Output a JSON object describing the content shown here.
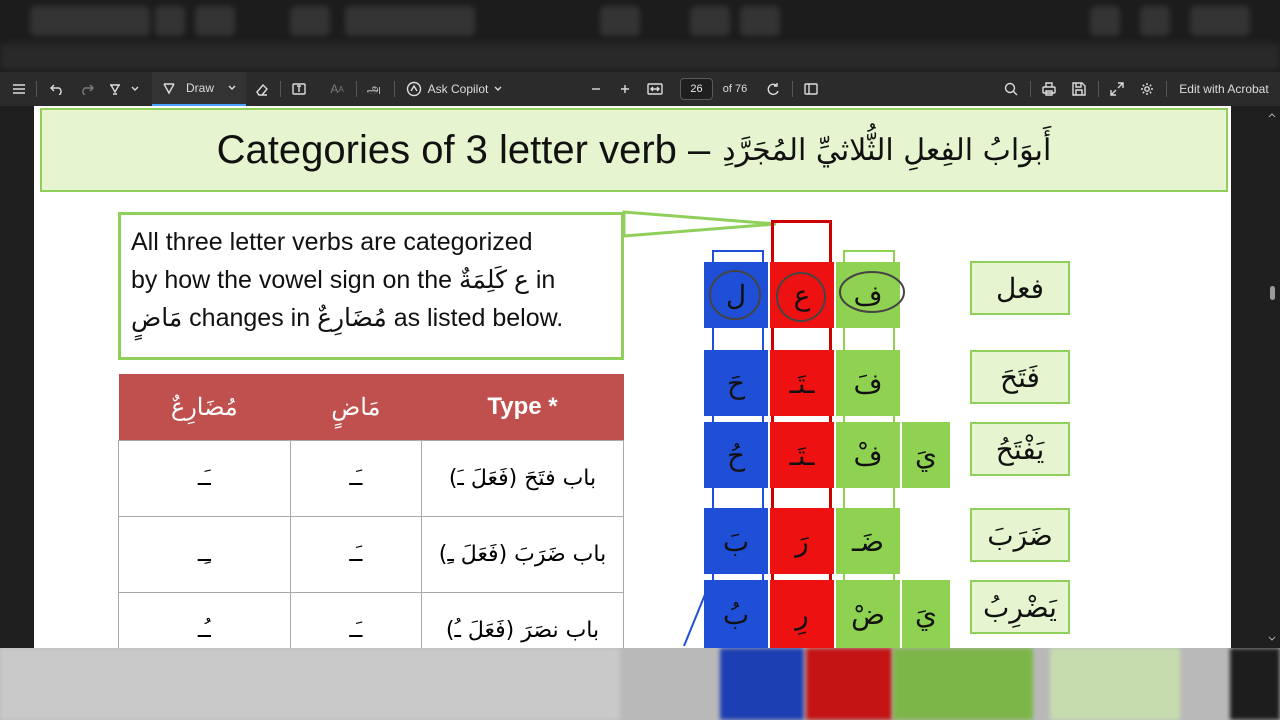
{
  "toolbar": {
    "draw_label": "Draw",
    "ask_copilot_label": "Ask Copilot",
    "page_current": "26",
    "page_total": "of 76",
    "edit_label": "Edit with Acrobat"
  },
  "slide": {
    "title_en": "Categories of 3 letter verb –",
    "title_ar": "أَبوَابُ الفِعلِ الثُّلاثيِّ المُجَرَّدِ",
    "callout_line1": "All three letter verbs are categorized",
    "callout_line2": "by how the vowel sign on the ع كَلِمَةٌ in",
    "callout_line3": "مَاضٍ changes in مُضَارِعٌ as listed below.",
    "table": {
      "headers": [
        "مُضَارِعٌ",
        "مَاضٍ",
        "Type *"
      ],
      "rows": [
        [
          "ـَـ",
          "ـَـ",
          "باب فتَحَ (فَعَلَ ـَ)"
        ],
        [
          "ـِـ",
          "ـَـ",
          "باب ضَرَبَ (فَعَلَ ـِ)"
        ],
        [
          "ـُـ",
          "ـَـ",
          "باب نصَرَ (فَعَلَ ـُ)"
        ]
      ]
    },
    "grid": {
      "row0": [
        "ل",
        "ع",
        "ف"
      ],
      "row1": [
        "حَ",
        "ـتَـ",
        "فَ"
      ],
      "row2": [
        "حُ",
        "ـتَـ",
        "فْ",
        "يَ"
      ],
      "row3": [
        "بَ",
        "رَ",
        "ضَـ"
      ],
      "row4": [
        "بُ",
        "رِ",
        "ضْ",
        "يَ"
      ]
    },
    "labels": [
      "فعل",
      "فَتَحَ",
      "يَفْتَحُ",
      "ضَرَبَ",
      "يَضْرِبُ"
    ]
  }
}
